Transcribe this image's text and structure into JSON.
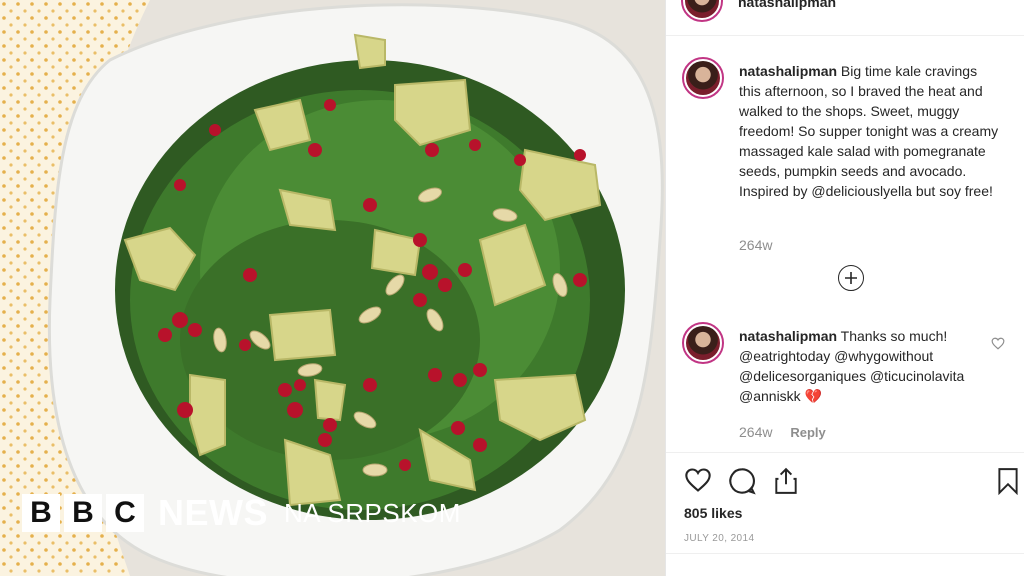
{
  "watermark": {
    "blocks": [
      "B",
      "B",
      "C"
    ],
    "news": "NEWS",
    "lang": "NA SRPSKOM"
  },
  "post": {
    "header_username": "natashalipman",
    "caption": {
      "username": "natashalipman",
      "text": "Big time kale cravings this afternoon, so I braved the heat and walked to the shops. Sweet, muggy freedom! So supper tonight was a creamy massaged kale salad with pomegranate seeds, pumpkin seeds and avocado. Inspired by @deliciouslyella but soy free!",
      "age": "264w"
    },
    "load_more_icon": "plus-circle-icon",
    "reply": {
      "username": "natashalipman",
      "text": "Thanks so much! @eatrightoday @whygowithout @delicesorganiques @ticucinolavita @anniskk 💔",
      "age": "264w",
      "reply_label": "Reply"
    },
    "likes": "805 likes",
    "date": "JULY 20, 2014"
  },
  "colors": {
    "accent_ring": "#c13584",
    "text": "#262626",
    "muted": "#8e8e8e"
  }
}
